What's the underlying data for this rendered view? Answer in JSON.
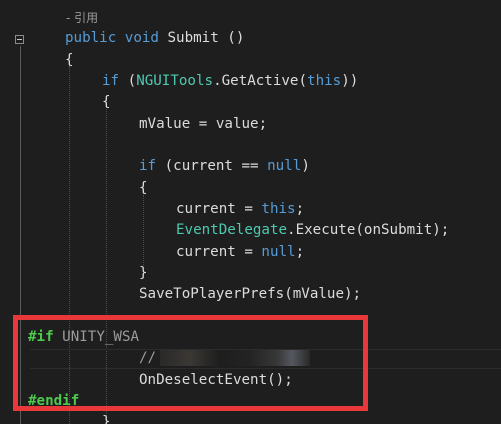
{
  "editor": {
    "codelens_text": "- 引用",
    "lines": [
      {
        "id": "signature",
        "parts": [
          {
            "t": "public",
            "c": "kw"
          },
          {
            "t": " ",
            "c": "plain"
          },
          {
            "t": "void",
            "c": "kw"
          },
          {
            "t": " Submit ()",
            "c": "plain"
          }
        ]
      },
      {
        "id": "open-brace-method",
        "parts": [
          {
            "t": "{",
            "c": "plain"
          }
        ]
      },
      {
        "id": "if-getactive",
        "parts": [
          {
            "t": "if",
            "c": "kw"
          },
          {
            "t": " (",
            "c": "plain"
          },
          {
            "t": "NGUITools",
            "c": "ty"
          },
          {
            "t": ".GetActive(",
            "c": "plain"
          },
          {
            "t": "this",
            "c": "kw"
          },
          {
            "t": "))",
            "c": "plain"
          }
        ]
      },
      {
        "id": "open-brace-if",
        "parts": [
          {
            "t": "{",
            "c": "plain"
          }
        ]
      },
      {
        "id": "assign-mvalue",
        "parts": [
          {
            "t": "mValue = value;",
            "c": "plain"
          }
        ]
      },
      {
        "id": "if-current-null",
        "parts": [
          {
            "t": "if",
            "c": "kw"
          },
          {
            "t": " (current == ",
            "c": "plain"
          },
          {
            "t": "null",
            "c": "kw"
          },
          {
            "t": ")",
            "c": "plain"
          }
        ]
      },
      {
        "id": "open-brace-inner",
        "parts": [
          {
            "t": "{",
            "c": "plain"
          }
        ]
      },
      {
        "id": "current-this",
        "parts": [
          {
            "t": "current = ",
            "c": "plain"
          },
          {
            "t": "this",
            "c": "kw"
          },
          {
            "t": ";",
            "c": "plain"
          }
        ]
      },
      {
        "id": "execute",
        "parts": [
          {
            "t": "EventDelegate",
            "c": "ty"
          },
          {
            "t": ".Execute(onSubmit);",
            "c": "plain"
          }
        ]
      },
      {
        "id": "current-null",
        "parts": [
          {
            "t": "current = ",
            "c": "plain"
          },
          {
            "t": "null",
            "c": "kw"
          },
          {
            "t": ";",
            "c": "plain"
          }
        ]
      },
      {
        "id": "close-brace-inner",
        "parts": [
          {
            "t": "}",
            "c": "plain"
          }
        ]
      },
      {
        "id": "save-prefs",
        "parts": [
          {
            "t": "SaveToPlayerPrefs(mValue);",
            "c": "plain"
          }
        ]
      },
      {
        "id": "pp-if",
        "parts": [
          {
            "t": "#if",
            "c": "pp-kw"
          },
          {
            "t": " UNITY_WSA",
            "c": "pp"
          }
        ]
      },
      {
        "id": "comment-line",
        "parts": [
          {
            "t": "//",
            "c": "gray"
          }
        ]
      },
      {
        "id": "ondeselect",
        "parts": [
          {
            "t": "OnDeselectEvent();",
            "c": "plain"
          }
        ]
      },
      {
        "id": "pp-endif",
        "parts": [
          {
            "t": "#endif",
            "c": "pp-kw"
          }
        ]
      },
      {
        "id": "close-brace-partial",
        "parts": [
          {
            "t": "}",
            "c": "plain"
          }
        ]
      }
    ]
  }
}
